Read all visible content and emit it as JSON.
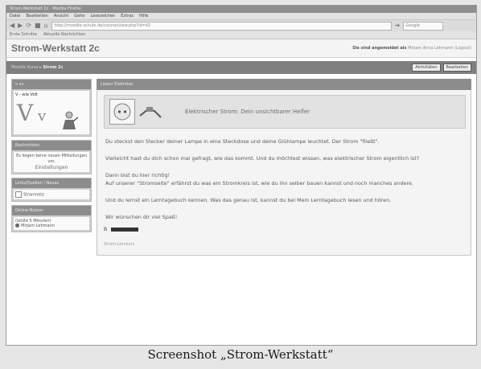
{
  "browser": {
    "title": "Strom-Werkstatt 2c - Mozilla Firefox",
    "menu": [
      "Datei",
      "Bearbeiten",
      "Ansicht",
      "Gehe",
      "Lesezeichen",
      "Extras",
      "Hilfe"
    ],
    "back_glyph": "◀",
    "forward_glyph": "▶",
    "reload_glyph": "⟳",
    "stop_glyph": "■",
    "home_glyph": "⌂",
    "url": "http://moodle.schule.de/course/view.php?id=42",
    "search_placeholder": "Google",
    "bookmarks": [
      "Erste Schritte",
      "Aktuelle Nachrichten"
    ]
  },
  "site": {
    "title": "Strom-Werkstatt 2c",
    "login_prefix": "Sie sind angemeldet als",
    "login_user": "Mirjam Anna Lehmann",
    "logout_label": "(Logout)"
  },
  "breadcrumb": {
    "home": "Moodle Kurse",
    "separator": "▸",
    "current": "Strom 2c",
    "buttons": [
      "Aktivitäten",
      "Bearbeiten"
    ]
  },
  "sidebar": {
    "vv": {
      "head": "v vv",
      "caption": "V - wie Volt",
      "big": "V",
      "small": "v"
    },
    "news": {
      "head": "Nachrichten",
      "body": "Es liegen keine neuen Mitteilungen vor.",
      "link": "Einstellungen"
    },
    "links": {
      "head": "Links/Quellen / Neues",
      "item": "Stromnetz"
    },
    "online": {
      "head": "Online-Nutzer",
      "body": "(letzte 5 Minuten)",
      "user": "Mirjam Lehmann"
    }
  },
  "main": {
    "panel_title": "Lieber Elektriker",
    "banner_text": "Elektrischer Strom: Dein unsichtbarer Helfer",
    "paragraphs": [
      "Du steckst den Stecker deiner Lampe in eine Steckdose und deine Glühlampe leuchtet. Der Strom \"fließt\".",
      "Vielleicht hast du dich schon mal gefragt, wie das kommt. Und du möchtest wissen, was elektrischer Strom eigentlich ist?",
      "Dann bist du hier richtig!\nAuf unserer \"Stromseite\" erfährst du was ein Stromkreis ist, wie du ihn selber bauen kannst und noch manches andere.",
      "Und du lernst ein Lerntagebuch kennen. Was das genau ist, kannst du bei Mein Lerntagebuch lesen und hören.",
      "Wir wünschen dir viel Spaß!"
    ],
    "signature_prefix": "B",
    "footnote": "Strom-Lernkurs"
  },
  "caption": "Screenshot „Strom-Werkstatt“"
}
